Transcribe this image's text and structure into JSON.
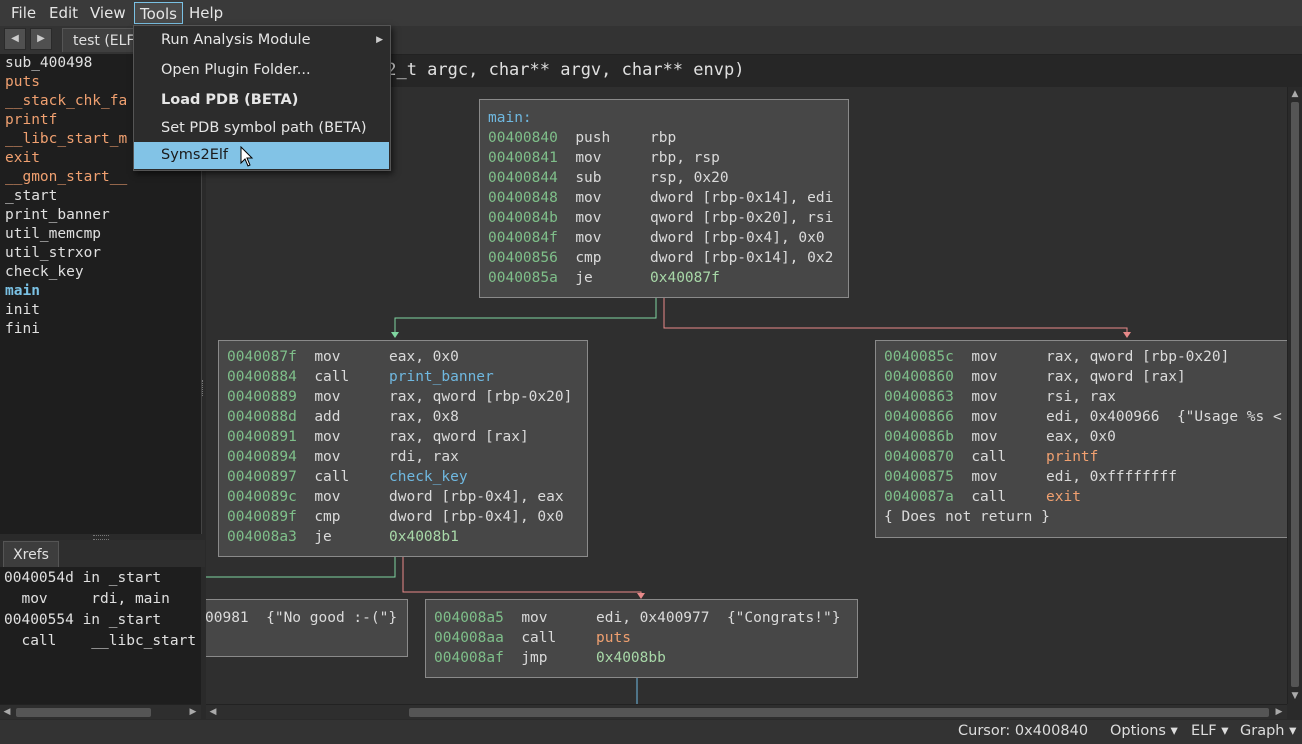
{
  "menubar": {
    "items": [
      "File",
      "Edit",
      "View",
      "Tools",
      "Help"
    ]
  },
  "tabs": {
    "back_icon": "arrow-left-icon",
    "forward_icon": "arrow-right-icon",
    "active_tab": "test (ELF"
  },
  "symbols": [
    "sub_400498",
    "puts",
    "__stack_chk_fa",
    "printf",
    "__libc_start_m",
    "exit",
    "__gmon_start__",
    "_start",
    "print_banner",
    "util_memcmp",
    "util_strxor",
    "check_key",
    "main",
    "init",
    "fini"
  ],
  "xrefs": {
    "tab_label": "Xrefs",
    "lines": [
      "0040054d in _start",
      "  mov     rdi, main",
      "00400554 in _start",
      "  call    __libc_start"
    ]
  },
  "signature": "32_t argc, char** argv, char** envp)",
  "tools_menu": {
    "items": [
      "Run Analysis Module",
      "Open Plugin Folder...",
      "Load PDB (BETA)",
      "Set PDB symbol path (BETA)",
      "Syms2Elf"
    ]
  },
  "blocks": {
    "main": {
      "label": "main:",
      "rows": [
        [
          "00400840",
          "push",
          "rbp"
        ],
        [
          "00400841",
          "mov",
          "rbp, rsp"
        ],
        [
          "00400844",
          "sub",
          "rsp, 0x20"
        ],
        [
          "00400848",
          "mov",
          "dword [rbp-0x14], edi"
        ],
        [
          "0040084b",
          "mov",
          "qword [rbp-0x20], rsi"
        ],
        [
          "0040084f",
          "mov",
          "dword [rbp-0x4], 0x0"
        ],
        [
          "00400856",
          "cmp",
          "dword [rbp-0x14], 0x2"
        ],
        [
          "0040085a",
          "je",
          "0x40087f"
        ]
      ]
    },
    "left": {
      "rows": [
        [
          "0040087f",
          "mov",
          "eax, 0x0"
        ],
        [
          "00400884",
          "call",
          "print_banner"
        ],
        [
          "00400889",
          "mov",
          "rax, qword [rbp-0x20]"
        ],
        [
          "0040088d",
          "add",
          "rax, 0x8"
        ],
        [
          "00400891",
          "mov",
          "rax, qword [rax]"
        ],
        [
          "00400894",
          "mov",
          "rdi, rax"
        ],
        [
          "00400897",
          "call",
          "check_key"
        ],
        [
          "0040089c",
          "mov",
          "dword [rbp-0x4], eax"
        ],
        [
          "0040089f",
          "cmp",
          "dword [rbp-0x4], 0x0"
        ],
        [
          "004008a3",
          "je",
          "0x4008b1"
        ]
      ]
    },
    "right": {
      "rows": [
        [
          "0040085c",
          "mov",
          "rax, qword [rbp-0x20]"
        ],
        [
          "00400860",
          "mov",
          "rax, qword [rax]"
        ],
        [
          "00400863",
          "mov",
          "rsi, rax"
        ],
        [
          "00400866",
          "mov",
          "edi, 0x400966  {\"Usage %s <"
        ],
        [
          "0040086b",
          "mov",
          "eax, 0x0"
        ],
        [
          "00400870",
          "call",
          "printf"
        ],
        [
          "00400875",
          "mov",
          "edi, 0xffffffff"
        ],
        [
          "0040087a",
          "call",
          "exit"
        ]
      ],
      "footer": "{ Does not return }"
    },
    "bottom_left": {
      "text": "00981  {\"No good :-(\"}"
    },
    "bottom_right": {
      "rows": [
        [
          "004008a5",
          "mov",
          "edi, 0x400977  {\"Congrats!\"}"
        ],
        [
          "004008aa",
          "call",
          "puts"
        ],
        [
          "004008af",
          "jmp",
          "0x4008bb"
        ]
      ]
    }
  },
  "status": {
    "cursor": "Cursor: 0x400840",
    "options": "Options ▾",
    "elf": "ELF ▾",
    "graph": "Graph ▾"
  },
  "colors": {
    "accent": "#82c3e6",
    "address": "#7fbf8a",
    "call_target": "#6fb8e0",
    "true_edge": "#7fd6a0",
    "false_edge": "#e88a8a"
  }
}
